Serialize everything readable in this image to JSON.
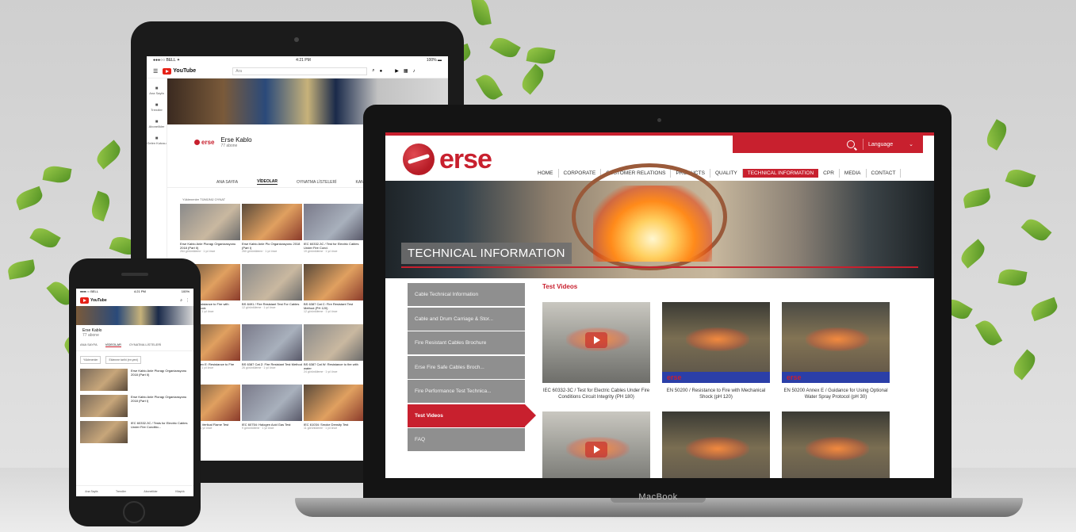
{
  "tablet": {
    "status_carrier": "●●●○○ BELL ✦",
    "status_time": "4:21 PM",
    "status_battery": "100% ▬",
    "yt_logo": "YouTube",
    "rail": [
      "Ana Sayfa",
      "Trendler",
      "Abonelikler",
      "Gelen Kutusu"
    ],
    "channel_brand": "erse",
    "channel_name": "Erse Kablo",
    "channel_subs": "77 abone",
    "tabs": [
      "ANA SAYFA",
      "VİDEOLAR",
      "OYNATMA LİSTELERİ",
      "KANALLAR"
    ],
    "sort": "Yüklenenler   TÜMÜNÜ OYNAT",
    "videos": [
      {
        "title": "Erse Kablo Anle Ploragı Organizasyonu 2018 (Part II)",
        "meta": "264 görüntüleme · 1 yıl önce"
      },
      {
        "title": "Erse Kablo Anle Plo Organizasyonu 2018 (Part I)",
        "meta": "260 görüntüleme · 1 yıl önce"
      },
      {
        "title": "IEC 60332-3C / Test for Electric Cables Under Fire Cond.",
        "meta": "19 görüntüleme · 1 yıl önce"
      },
      {
        "title": "EN 50200 / Resistance to Fire with Mechanical Shock",
        "meta": "61 görüntüleme · 1 yıl önce"
      },
      {
        "title": "BS 8491 / Fire Resistant Test For Cables",
        "meta": "12 görüntüleme · 1 yıl önce"
      },
      {
        "title": "BS 6387 Cat C: Fire Resistant Test Method (PH 120)",
        "meta": "12 görüntüleme · 1 yıl önce"
      },
      {
        "title": "EN 50200 Annex E: Resistance to Fire",
        "meta": "11 görüntüleme · 1 yıl önce"
      },
      {
        "title": "BS 6387 Cat Z: Fire Resistant Test Method",
        "meta": "26 görüntüleme · 1 yıl önce"
      },
      {
        "title": "BS 6387 Cat W: Resistance to fire with water",
        "meta": "24 görüntüleme · 1 yıl önce"
      },
      {
        "title": "IEC 60332-3C: Vertical Flame Test",
        "meta": "8 görüntüleme · 1 yıl önce"
      },
      {
        "title": "IEC 60754: Halogen Acid Gas Test",
        "meta": "9 görüntüleme · 1 yıl önce"
      },
      {
        "title": "IEC 61034: Smoke Density Test",
        "meta": "11 görüntüleme · 1 yıl önce"
      }
    ]
  },
  "laptop": {
    "brand": "MacBook",
    "logo_text": "erse",
    "language": "Language",
    "nav": [
      "HOME",
      "CORPORATE",
      "CUSTOMER RELATIONS",
      "PRODUCTS",
      "QUALITY",
      "TECHNICAL INFORMATION",
      "CPR",
      "MEDIA",
      "CONTACT"
    ],
    "hero_title": "TECHNICAL INFORMATION",
    "sidebar": [
      "Cable Technical Information",
      "Cable and Drum Carriage & Stor...",
      "Fire Resistant Cables Brochure",
      "Erse Fire Safe Cables Broch...",
      "Fire Performance Test Technica...",
      "Test Videos",
      "FAQ"
    ],
    "content_title": "Test Videos",
    "videos": [
      {
        "caption": "IEC 60332-3C / Test for Electric Cables Under Fire Conditions Circuit Integrity (PH 180)",
        "style": "t1",
        "brand": ""
      },
      {
        "caption": "EN 50200 / Resistance to Fire with Mechanical Shock (pH 120)",
        "style": "t2",
        "brand": "erse"
      },
      {
        "caption": "EN 50200 Annex E / Guidance for Using Optional Water Spray Protocol (pH 30)",
        "style": "t3",
        "brand": "erse"
      },
      {
        "caption": "",
        "style": "t1",
        "brand": ""
      },
      {
        "caption": "",
        "style": "t2",
        "brand": ""
      },
      {
        "caption": "",
        "style": "t2",
        "brand": ""
      }
    ]
  },
  "phone": {
    "status_carrier": "●●●○○ BELL",
    "status_time": "4:21 PM",
    "status_battery": "100%",
    "yt_logo": "YouTube",
    "channel_name": "Erse Kablo",
    "channel_subs": "77 abone",
    "tabs": [
      "ANA SAYFA",
      "VİDEOLAR",
      "OYNATMA LİSTELERİ"
    ],
    "filters": [
      "Yüklenenler",
      "Eklenme tarihi (en yeni)"
    ],
    "rows": [
      {
        "title": "Erse Kablo Anle Ploragı Organizasyonu 2018 (Part II)"
      },
      {
        "title": "Erse Kablo Anle Ploragı Organizasyonu 2018 (Part I)"
      },
      {
        "title": "IEC 60332-3C / Tests for Electric Cables Under Fire Conditio..."
      }
    ],
    "nav": [
      "Ana Sayfa",
      "Trendler",
      "Abonelikler",
      "Kitaplık"
    ]
  }
}
